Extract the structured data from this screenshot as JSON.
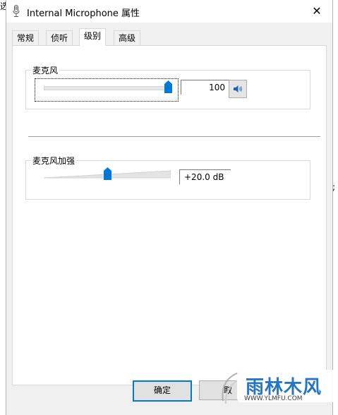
{
  "window": {
    "title": "Internal Microphone 属性",
    "close_glyph": "✕"
  },
  "tabs": [
    {
      "label": "常规",
      "active": false
    },
    {
      "label": "侦听",
      "active": false
    },
    {
      "label": "级别",
      "active": true
    },
    {
      "label": "高级",
      "active": false
    }
  ],
  "microphone": {
    "label": "麦克风",
    "value": "100",
    "level": 1.0,
    "mute_icon": "speaker-icon"
  },
  "boost": {
    "label": "麦克风加强",
    "value": "+20.0 dB",
    "level": 0.5
  },
  "buttons": {
    "ok": "确定",
    "cancel": "取"
  },
  "background": {
    "left_char": "选",
    "right_char": ";"
  },
  "watermark": {
    "title": "雨林木风",
    "url": "WWW.YLMFU.COM"
  },
  "colors": {
    "accent": "#0078d7",
    "panel": "#f0f0f0"
  }
}
